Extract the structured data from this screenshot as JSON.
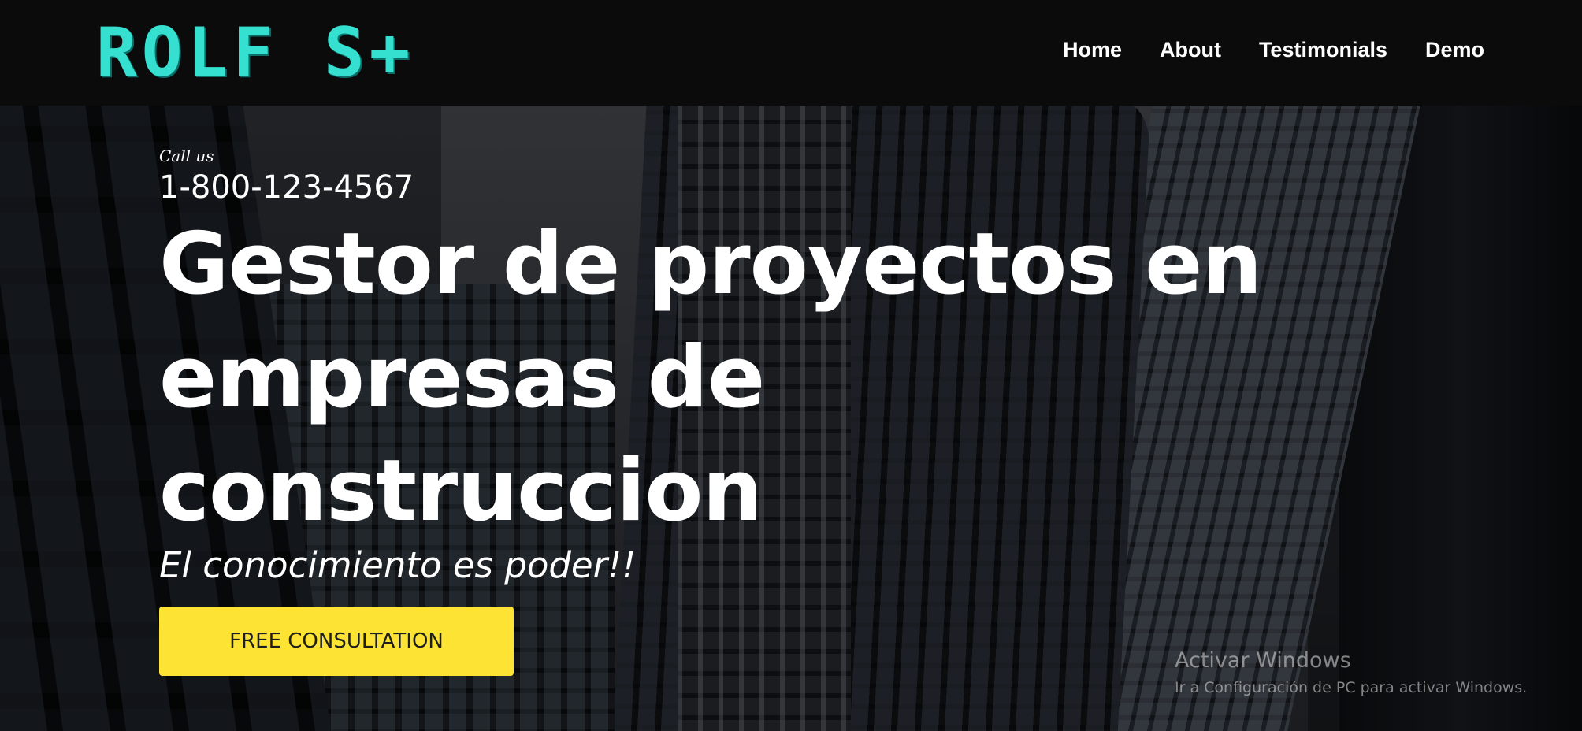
{
  "header": {
    "logo_text": "ROLF S+",
    "nav": [
      {
        "label": "Home"
      },
      {
        "label": "About"
      },
      {
        "label": "Testimonials"
      },
      {
        "label": "Demo"
      }
    ]
  },
  "hero": {
    "call_label": "Call us",
    "phone": "1-800-123-4567",
    "headline_line1": "Gestor de proyectos en",
    "headline_line2": "empresas de construccion",
    "tagline": "El conocimiento es poder!!",
    "cta_label": "FREE CONSULTATION"
  },
  "watermark": {
    "title": "Activar Windows",
    "subtitle": "Ir a Configuración de PC para activar Windows."
  },
  "colors": {
    "logo": "#35e0d0",
    "cta_background": "#fde434",
    "navbar_background": "#0b0b0b"
  }
}
